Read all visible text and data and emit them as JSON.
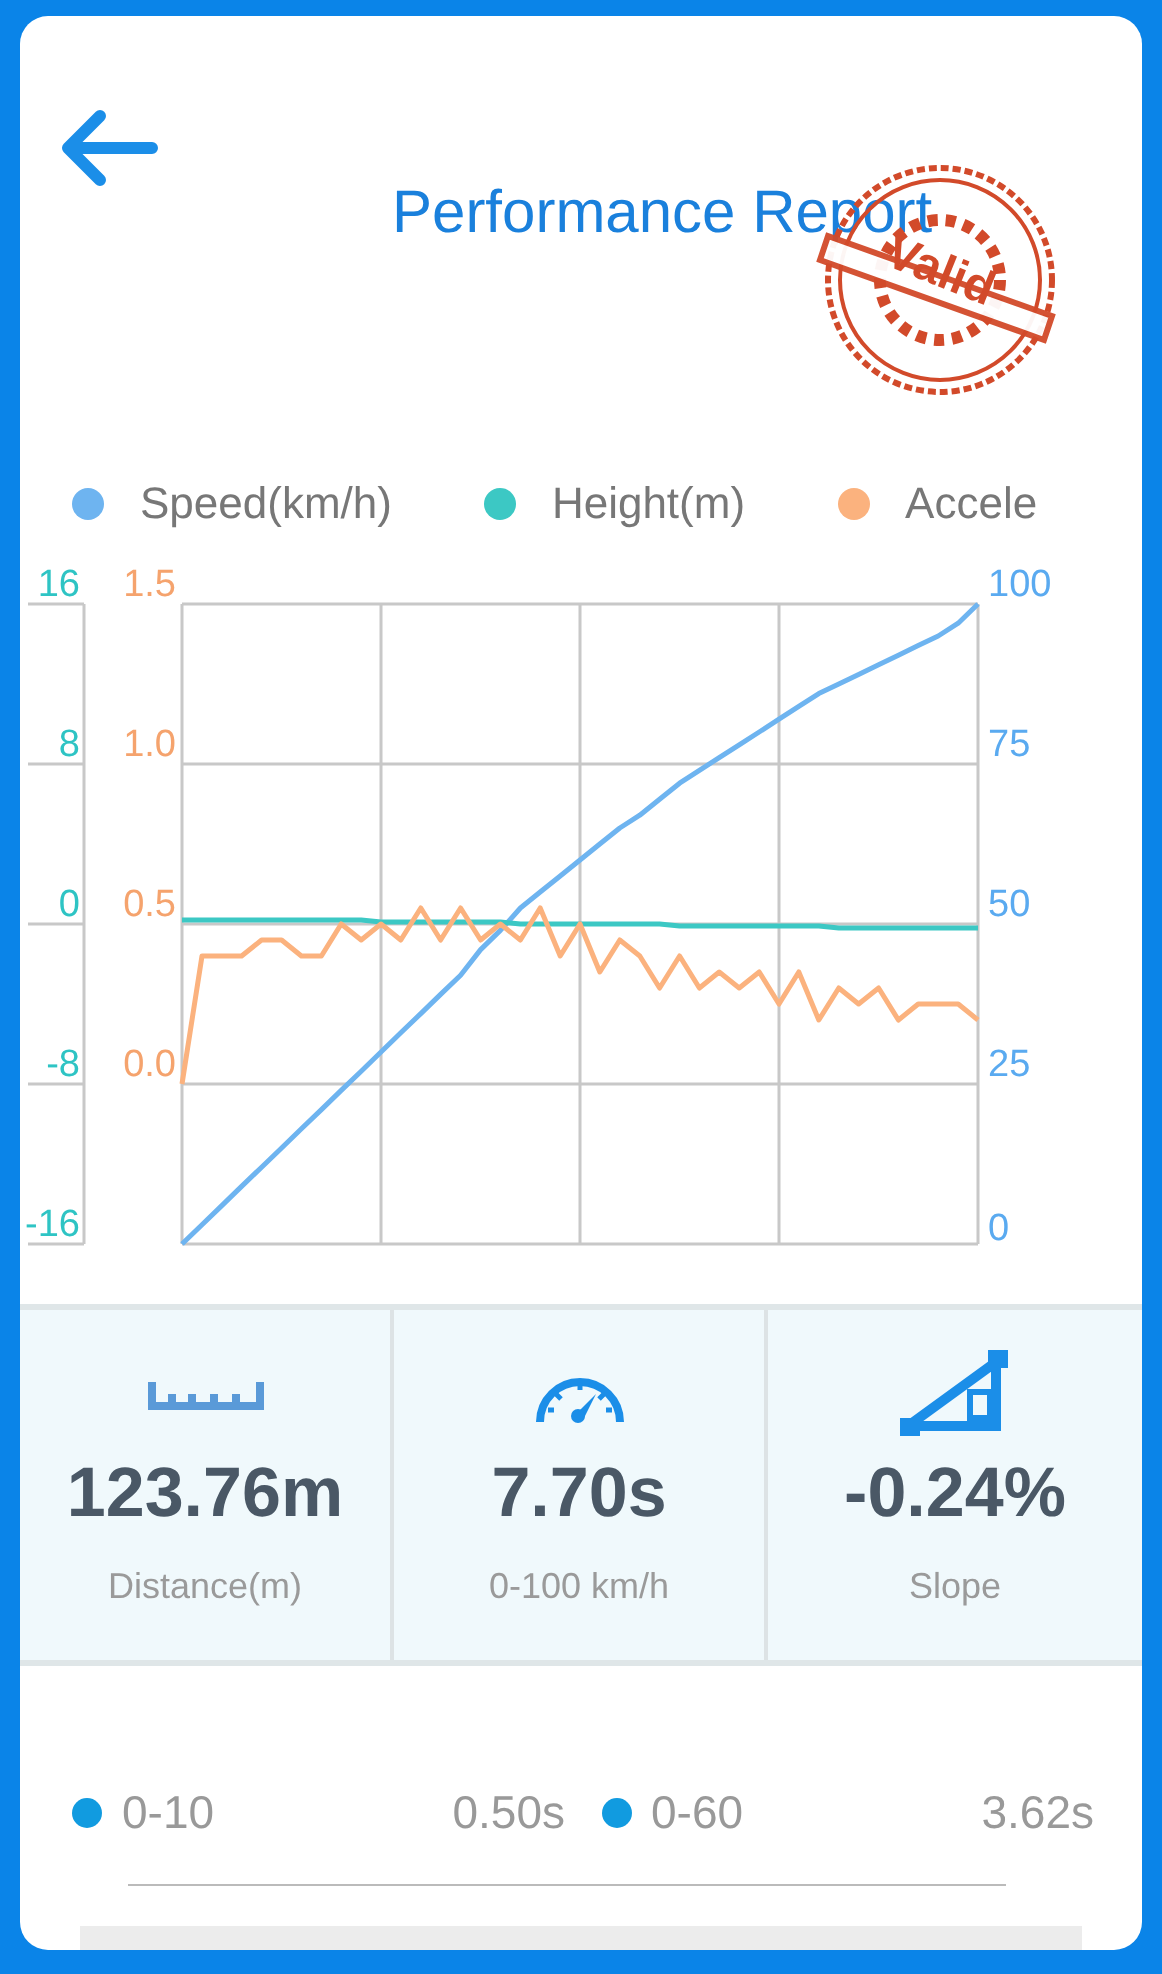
{
  "header": {
    "title": "Performance Report",
    "stamp": "Valid"
  },
  "chart_data": {
    "type": "line",
    "grid": true,
    "ylim": [
      0,
      100
    ],
    "yticks": [
      0,
      25,
      50,
      75,
      100
    ],
    "y2lim": [
      -16,
      16
    ],
    "y2ticks": [
      -16,
      -8,
      0,
      8,
      16
    ],
    "y3lim": [
      -0.5,
      1.5
    ],
    "y3ticks": [
      {
        "value": 0,
        "label": "0.0"
      },
      {
        "value": 0.5,
        "label": "0.5"
      },
      {
        "value": 1,
        "label": "1.0"
      },
      {
        "value": 1.5,
        "label": "1.5"
      }
    ],
    "series": [
      {
        "name": "Speed(km/h)",
        "color": "#6eb4f0",
        "values": [
          0,
          3,
          6,
          9,
          12,
          15,
          18,
          21,
          24,
          27,
          30,
          33,
          36,
          39,
          42,
          46,
          49,
          52.5,
          55,
          57.5,
          60,
          62.5,
          65,
          67,
          69.5,
          72,
          74,
          76,
          78,
          80,
          82,
          84,
          86,
          87.5,
          89,
          90.5,
          92,
          93.5,
          95,
          97,
          100
        ]
      },
      {
        "name": "Height(m)",
        "color": "#3cc8c4",
        "axis": "y2",
        "values": [
          0.2,
          0.2,
          0.2,
          0.2,
          0.2,
          0.2,
          0.2,
          0.2,
          0.2,
          0.2,
          0.1,
          0.1,
          0.1,
          0.1,
          0.1,
          0.1,
          0.1,
          0,
          0,
          0,
          0,
          0,
          0,
          0,
          0,
          -0.1,
          -0.1,
          -0.1,
          -0.1,
          -0.1,
          -0.1,
          -0.1,
          -0.1,
          -0.2,
          -0.2,
          -0.2,
          -0.2,
          -0.2,
          -0.2,
          -0.2,
          -0.2
        ]
      },
      {
        "name": "Accele",
        "color": "#fbb27e",
        "axis": "y3",
        "values": [
          0.0,
          0.4,
          0.4,
          0.4,
          0.45,
          0.45,
          0.4,
          0.4,
          0.5,
          0.45,
          0.5,
          0.45,
          0.55,
          0.45,
          0.55,
          0.45,
          0.5,
          0.45,
          0.55,
          0.4,
          0.5,
          0.35,
          0.45,
          0.4,
          0.3,
          0.4,
          0.3,
          0.35,
          0.3,
          0.35,
          0.25,
          0.35,
          0.2,
          0.3,
          0.25,
          0.3,
          0.2,
          0.25,
          0.25,
          0.25,
          0.2
        ]
      }
    ]
  },
  "stats": [
    {
      "kind": "distance",
      "value": "123.76m",
      "label": "Distance(m)"
    },
    {
      "kind": "speed",
      "value": "7.70s",
      "label": "0-100 km/h"
    },
    {
      "kind": "slope",
      "value": "-0.24%",
      "label": "Slope"
    }
  ],
  "splits": [
    {
      "range": "0-10",
      "time": "0.50s"
    },
    {
      "range": "0-60",
      "time": "3.62s"
    }
  ]
}
